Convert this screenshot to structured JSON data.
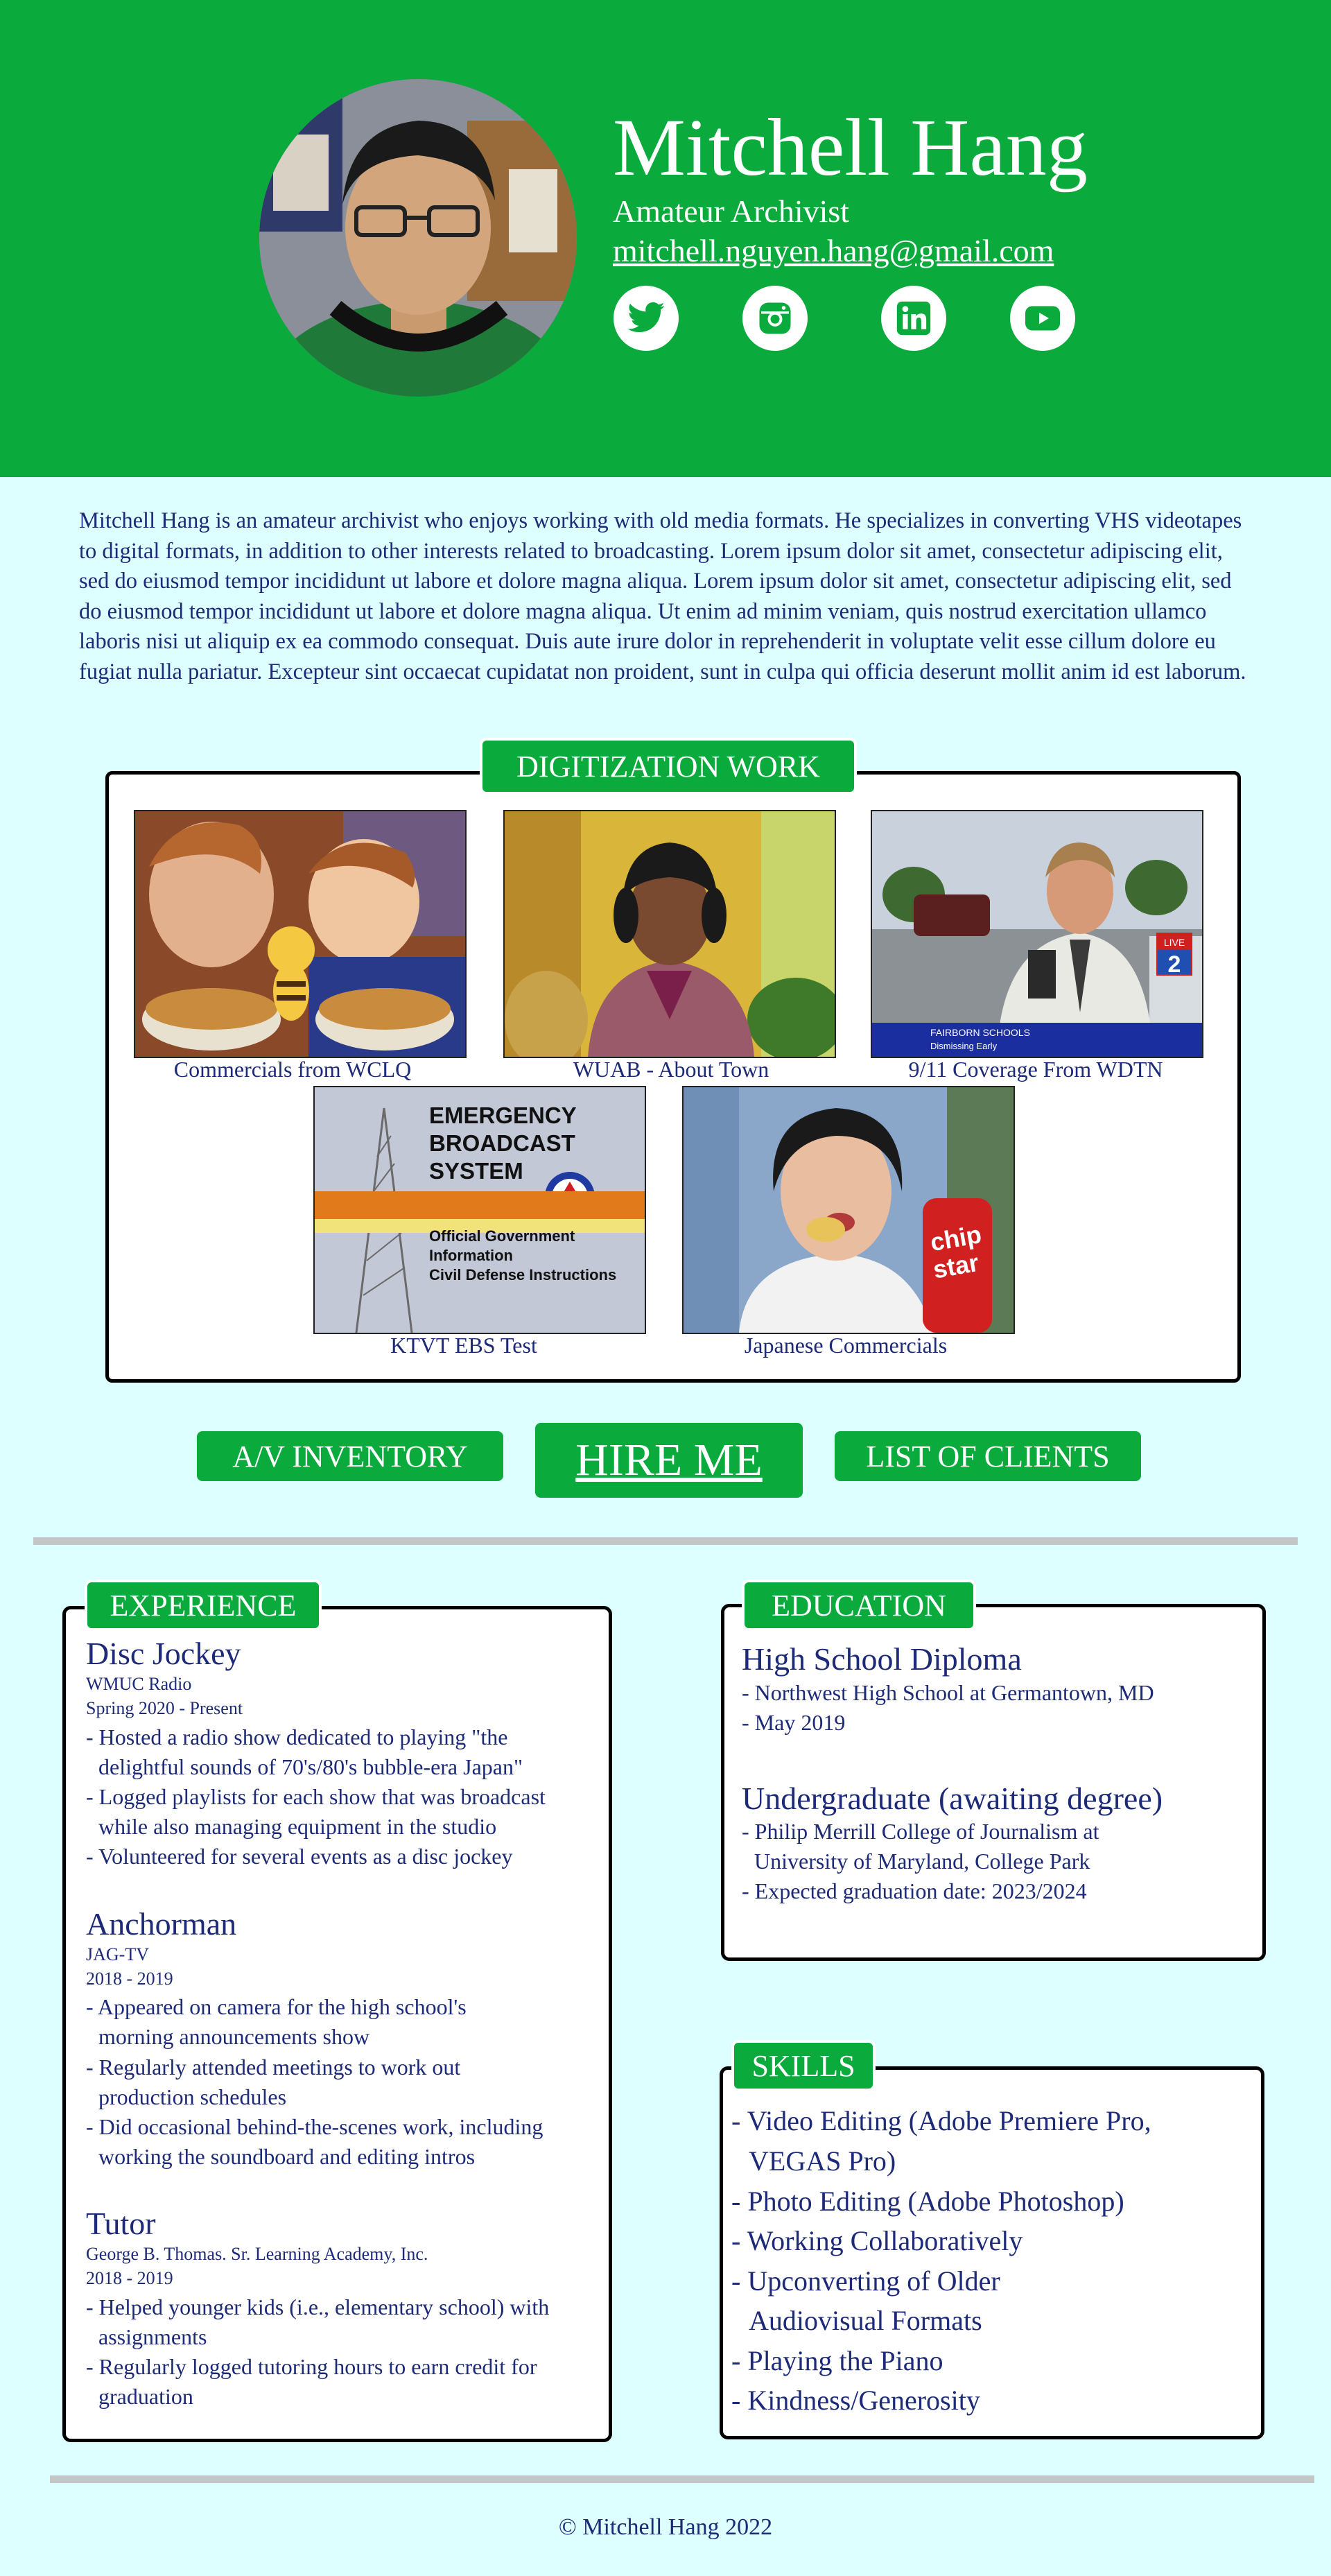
{
  "header": {
    "name": "Mitchell Hang",
    "role": "Amateur Archivist",
    "email": "mitchell.nguyen.hang@gmail.com",
    "avatar_alt": "profile photo",
    "social": [
      {
        "icon": "twitter-icon"
      },
      {
        "icon": "instagram-icon"
      },
      {
        "icon": "linkedin-icon"
      },
      {
        "icon": "youtube-icon"
      }
    ]
  },
  "bio": "Mitchell Hang is an amateur archivist who enjoys working with old media formats. He specializes in converting VHS videotapes to digital formats, in addition to other interests related to broadcasting. Lorem ipsum dolor sit amet, consectetur adipiscing elit, sed do eiusmod tempor incididunt ut labore et dolore magna aliqua. Lorem ipsum dolor sit amet, consectetur adipiscing elit, sed do eiusmod tempor incididunt ut labore et dolore magna aliqua. Ut enim ad minim veniam, quis nostrud exercitation ullamco laboris nisi ut aliquip ex ea commodo consequat. Duis aute irure dolor in reprehenderit in voluptate velit esse cillum dolore eu fugiat nulla pariatur. Excepteur sint occaecat cupidatat non proident, sunt in culpa qui officia deserunt mollit anim id est laborum.",
  "digitization": {
    "title": "DIGITIZATION WORK",
    "items": [
      {
        "caption": "Commercials from WCLQ"
      },
      {
        "caption": "WUAB - About Town"
      },
      {
        "caption": "9/11 Coverage From WDTN",
        "overlay_text": "FAIRBORN SCHOOLS",
        "overlay_sub": "Dismissing Early",
        "badge": "LIVE"
      },
      {
        "caption": "KTVT EBS Test",
        "screen_lines": [
          "EMERGENCY",
          "BROADCAST",
          "SYSTEM"
        ],
        "band_lines": [
          "Official Government",
          "Information",
          "Civil Defense Instructions"
        ]
      },
      {
        "caption": "Japanese Commercials"
      }
    ]
  },
  "buttons": {
    "inventory": "A/V  INVENTORY",
    "hire": "HIRE ME",
    "clients": "LIST OF CLIENTS"
  },
  "experience": {
    "title": "EXPERIENCE",
    "jobs": [
      {
        "title": "Disc Jockey",
        "org": "WMUC Radio",
        "dates": "Spring 2020 - Present",
        "lines": [
          "- Hosted a radio show dedicated to playing \"the",
          "  delightful sounds of 70's/80's bubble-era Japan\"",
          "- Logged playlists for each show that was broadcast",
          "  while also managing equipment in the studio",
          "- Volunteered for several events as a disc jockey"
        ]
      },
      {
        "title": "Anchorman",
        "org": "JAG-TV",
        "dates": "2018 - 2019",
        "lines": [
          "- Appeared on camera for the high school's",
          "  morning announcements show",
          "- Regularly attended meetings to work out",
          "  production schedules",
          "- Did occasional behind-the-scenes work, including",
          "  working the soundboard and editing intros"
        ]
      },
      {
        "title": "Tutor",
        "org": "George B. Thomas. Sr. Learning Academy, Inc.",
        "dates": "2018 - 2019",
        "lines": [
          "- Helped younger kids (i.e., elementary school) with",
          "  assignments",
          "- Regularly logged tutoring hours to earn credit for",
          "  graduation"
        ]
      }
    ]
  },
  "education": {
    "title": "EDUCATION",
    "entries": [
      {
        "title": "High School Diploma",
        "lines": [
          "- Northwest High School at Germantown, MD",
          "- May 2019"
        ]
      },
      {
        "title": "Undergraduate (awaiting degree)",
        "lines": [
          "- Philip Merrill College of Journalism at",
          "  University of Maryland, College Park",
          "- Expected graduation date: 2023/2024"
        ]
      }
    ]
  },
  "skills": {
    "title": "SKILLS",
    "lines": [
      "- Video Editing (Adobe Premiere Pro,",
      "  VEGAS Pro)",
      "- Photo Editing (Adobe Photoshop)",
      "- Working Collaboratively",
      "- Upconverting of Older",
      "  Audiovisual Formats",
      "- Playing the Piano",
      "- Kindness/Generosity"
    ]
  },
  "footer": "© Mitchell Hang 2022",
  "colors": {
    "accent": "#0aaa3c",
    "background": "#deffff",
    "text": "#1d2a78",
    "rule": "#c2c6c6"
  }
}
